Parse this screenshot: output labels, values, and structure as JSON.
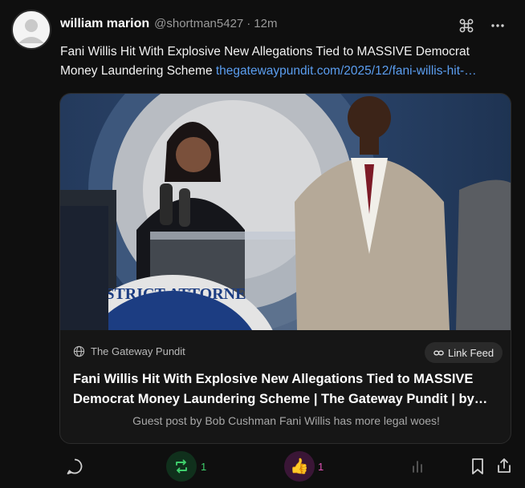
{
  "post": {
    "author_name": "william marion",
    "handle": "@shortman5427",
    "separator": "·",
    "time": "12m",
    "text": "Fani Willis Hit With Explosive New Allegations Tied to MASSIVE Democrat Money Laundering Scheme ",
    "link_text": "thegatewaypundit.com/2025/12/fani-willis-hit-…"
  },
  "card": {
    "source": "The Gateway Pundit",
    "link_feed_label": "Link Feed",
    "title_line1": "Fani Willis Hit With Explosive New Allegations Tied to MASSIVE",
    "title_line2": "Democrat Money Laundering Scheme | The Gateway Pundit | by…",
    "description": "Guest post by Bob Cushman Fani Willis has more legal woes!"
  },
  "actions": {
    "repost_count": "1",
    "like_count": "1",
    "like_emoji": "👍"
  },
  "icons": {
    "header": [
      "command-icon",
      "more-icon"
    ],
    "card": [
      "globe-icon",
      "chain-icon"
    ],
    "actions": [
      "reply-icon",
      "repost-icon",
      "thumbs-up-icon",
      "stats-icon",
      "bookmark-icon",
      "share-icon"
    ]
  },
  "colors": {
    "link": "#5b9ef0",
    "repost_active": "#3fcf6c",
    "like_active": "#e052b6",
    "background": "#0f0f0f"
  }
}
